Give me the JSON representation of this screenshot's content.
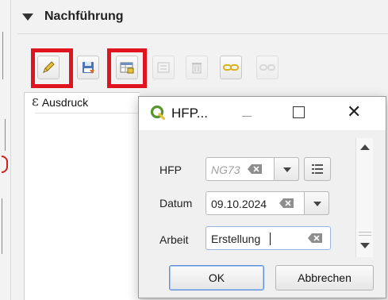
{
  "panel": {
    "title": "Nachführung",
    "toolbar": {
      "buttons": [
        {
          "name": "toggle-editing",
          "icon": "pencil-icon",
          "enabled": true,
          "highlighted": true
        },
        {
          "name": "save-edits",
          "icon": "save-icon",
          "enabled": true,
          "highlighted": false
        },
        {
          "name": "open-form",
          "icon": "form-table-icon",
          "enabled": true,
          "highlighted": true
        },
        {
          "name": "add-feature",
          "icon": "add-feature-icon",
          "enabled": false,
          "highlighted": false
        },
        {
          "name": "delete-feature",
          "icon": "trash-icon",
          "enabled": false,
          "highlighted": false
        },
        {
          "name": "link-feature",
          "icon": "link-icon",
          "enabled": true,
          "highlighted": false
        },
        {
          "name": "unlink-feature",
          "icon": "unlink-icon",
          "enabled": false,
          "highlighted": false
        }
      ]
    },
    "table": {
      "column_header": "Ausdruck"
    }
  },
  "dialog": {
    "title": "HFP...",
    "fields": {
      "hfp": {
        "label": "HFP",
        "value": "NG73"
      },
      "datum": {
        "label": "Datum",
        "value": "09.10.2024"
      },
      "arbeit": {
        "label": "Arbeit",
        "value": "Erstellung"
      }
    },
    "buttons": {
      "ok": "OK",
      "cancel": "Abbrechen"
    }
  },
  "colors": {
    "highlight": "#e0141e",
    "qgis_green": "#589632",
    "pencil_yellow": "#e8c23a"
  }
}
